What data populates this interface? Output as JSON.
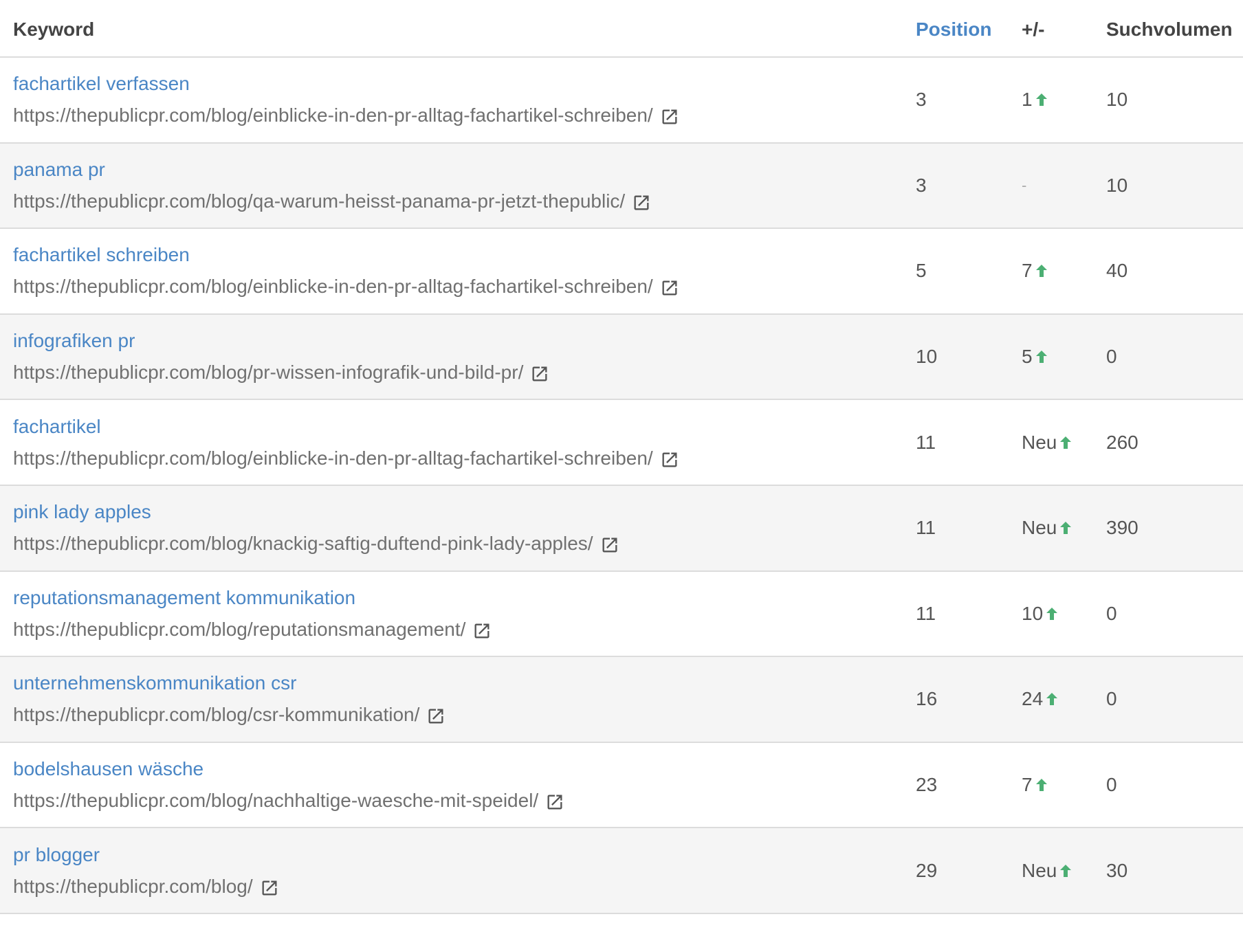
{
  "header": {
    "keyword": "Keyword",
    "position": "Position",
    "change": "+/-",
    "volume": "Suchvolumen"
  },
  "colors": {
    "link": "#4a86c5",
    "up_arrow": "#4caf73",
    "divider": "#dcdcdc",
    "alt_row": "#f5f5f5"
  },
  "rows": [
    {
      "keyword": "fachartikel verfassen",
      "url": "https://thepublicpr.com/blog/einblicke-in-den-pr-alltag-fachartikel-schreiben/",
      "position": "3",
      "change": "1",
      "trend": "up",
      "volume": "10"
    },
    {
      "keyword": "panama pr",
      "url": "https://thepublicpr.com/blog/qa-warum-heisst-panama-pr-jetzt-thepublic/",
      "position": "3",
      "change": "-",
      "trend": "none",
      "volume": "10"
    },
    {
      "keyword": "fachartikel schreiben",
      "url": "https://thepublicpr.com/blog/einblicke-in-den-pr-alltag-fachartikel-schreiben/",
      "position": "5",
      "change": "7",
      "trend": "up",
      "volume": "40"
    },
    {
      "keyword": "infografiken pr",
      "url": "https://thepublicpr.com/blog/pr-wissen-infografik-und-bild-pr/",
      "position": "10",
      "change": "5",
      "trend": "up",
      "volume": "0"
    },
    {
      "keyword": "fachartikel",
      "url": "https://thepublicpr.com/blog/einblicke-in-den-pr-alltag-fachartikel-schreiben/",
      "position": "11",
      "change": "Neu",
      "trend": "up",
      "volume": "260"
    },
    {
      "keyword": "pink lady apples",
      "url": "https://thepublicpr.com/blog/knackig-saftig-duftend-pink-lady-apples/",
      "position": "11",
      "change": "Neu",
      "trend": "up",
      "volume": "390"
    },
    {
      "keyword": "reputationsmanagement kommunikation",
      "url": "https://thepublicpr.com/blog/reputationsmanagement/",
      "position": "11",
      "change": "10",
      "trend": "up",
      "volume": "0"
    },
    {
      "keyword": "unternehmenskommunikation csr",
      "url": "https://thepublicpr.com/blog/csr-kommunikation/",
      "position": "16",
      "change": "24",
      "trend": "up",
      "volume": "0"
    },
    {
      "keyword": "bodelshausen wäsche",
      "url": "https://thepublicpr.com/blog/nachhaltige-waesche-mit-speidel/",
      "position": "23",
      "change": "7",
      "trend": "up",
      "volume": "0"
    },
    {
      "keyword": "pr blogger",
      "url": "https://thepublicpr.com/blog/",
      "position": "29",
      "change": "Neu",
      "trend": "up",
      "volume": "30"
    }
  ]
}
